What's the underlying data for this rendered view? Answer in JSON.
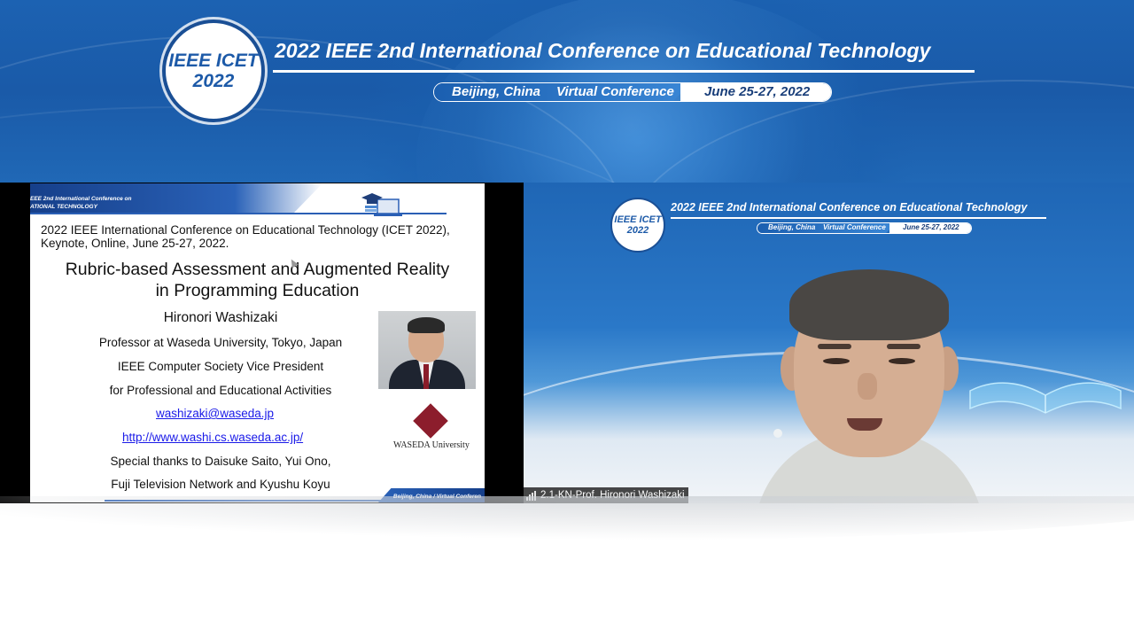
{
  "banner": {
    "logo_line1": "IEEE ICET",
    "logo_line2": "2022",
    "title": "2022 IEEE 2nd International Conference on Educational Technology",
    "location": "Beijing, China",
    "mode": "Virtual Conference",
    "dates": "June 25-27, 2022"
  },
  "slide": {
    "header_line1": "EEE 2nd International Conference on",
    "header_line2": "ATIONAL TECHNOLOGY",
    "event_line1": "2022 IEEE International Conference on Educational Technology (ICET 2022),",
    "event_line2": "Keynote, Online, June 25-27, 2022.",
    "title_line1": "Rubric-based Assessment and Augmented Reality",
    "title_line2": "in Programming Education",
    "speaker": "Hironori Washizaki",
    "affil1": "Professor at Waseda University, Tokyo, Japan",
    "affil2": "IEEE Computer Society Vice President",
    "affil3": "for Professional and Educational Activities",
    "email": "washizaki@waseda.jp",
    "url": "http://www.washi.cs.waseda.ac.jp/",
    "thanks1": "Special thanks to Daisuke Saito, Yui Ono,",
    "thanks2": "Fuji Television Network and Kyushu Koyu",
    "university_logo_text": "WASEDA University",
    "footer": "Beijing, China / Virtual Conferen"
  },
  "video": {
    "logo_line1": "IEEE ICET",
    "logo_line2": "2022",
    "title": "2022 IEEE 2nd International Conference on Educational Technology",
    "location": "Beijing, China",
    "mode": "Virtual Conference",
    "dates": "June 25-27, 2022",
    "participant_name": "2.1-KN-Prof. Hironori Washizaki"
  },
  "colors": {
    "banner_blue": "#1c62b2",
    "logo_blue": "#1d5aa8",
    "link_blue": "#1a1ae8",
    "waseda_red": "#8c1d2c"
  }
}
